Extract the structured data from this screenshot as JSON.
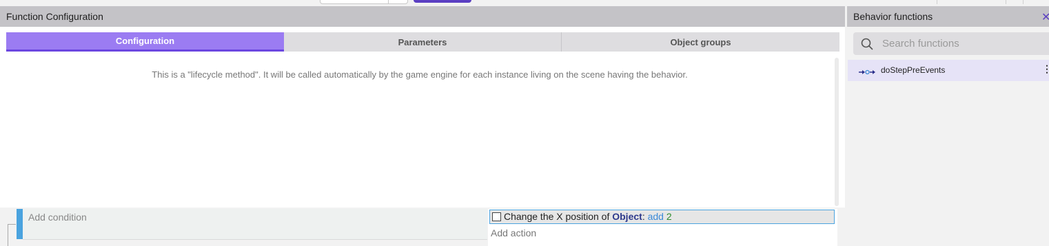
{
  "function_configuration": {
    "title": "Function Configuration",
    "tabs": [
      {
        "label": "Configuration",
        "active": true
      },
      {
        "label": "Parameters",
        "active": false
      },
      {
        "label": "Object groups",
        "active": false
      }
    ],
    "description": "This is a \"lifecycle method\". It will be called automatically by the game engine for each instance living on the scene having the behavior."
  },
  "events": {
    "add_condition": "Add condition",
    "action": {
      "prefix": "Change the X position of ",
      "object": "Object",
      "colon": ":",
      "operator": "add",
      "value": "2"
    },
    "add_action": "Add action"
  },
  "behavior_functions": {
    "title": "Behavior functions",
    "close_icon": "close-icon",
    "search": {
      "placeholder": "Search functions",
      "value": ""
    },
    "items": [
      {
        "label": "doStepPreEvents",
        "icon": "lifecycle-icon"
      }
    ]
  },
  "colors": {
    "accent": "#9b7cf2",
    "accent_dark": "#5b3fc2",
    "event_bar": "#4aa3df"
  }
}
